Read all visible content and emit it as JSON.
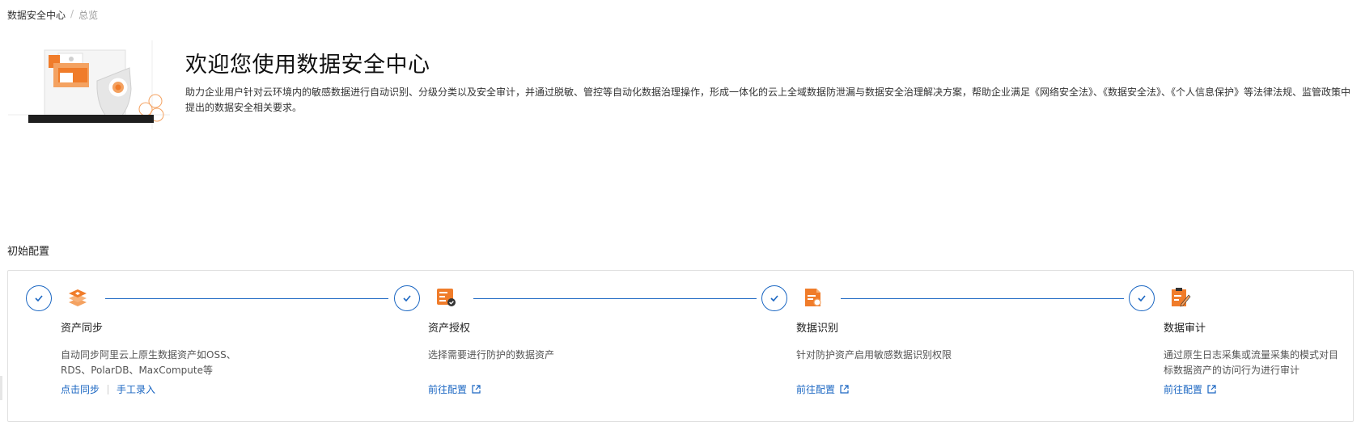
{
  "breadcrumb": {
    "root": "数据安全中心",
    "separator": "/",
    "current": "总览"
  },
  "hero": {
    "title": "欢迎您使用数据安全中心",
    "description": "助力企业用户针对云环境内的敏感数据进行自动识别、分级分类以及安全审计，并通过脱敏、管控等自动化数据治理操作，形成一体化的云上全域数据防泄漏与数据安全治理解决方案，帮助企业满足《网络安全法》、《数据安全法》、《个人信息保护》等法律法规、监管政策中提出的数据安全相关要求。"
  },
  "config": {
    "section_title": "初始配置",
    "steps": [
      {
        "title": "资产同步",
        "desc_line1": "自动同步阿里云上原生数据资产如OSS、",
        "desc_line2": "RDS、PolarDB、MaxCompute等",
        "action1": "点击同步",
        "action2": "手工录入"
      },
      {
        "title": "资产授权",
        "desc_line1": "选择需要进行防护的数据资产",
        "action1": "前往配置"
      },
      {
        "title": "数据识别",
        "desc_line1": "针对防护资产启用敏感数据识别权限",
        "action1": "前往配置"
      },
      {
        "title": "数据审计",
        "desc_line1": "通过原生日志采集或流量采集的模式对目",
        "desc_line2": "标数据资产的访问行为进行审计",
        "action1": "前往配置"
      }
    ]
  },
  "colors": {
    "accent_blue": "#1a66c2",
    "orange": "#f07c2a"
  }
}
